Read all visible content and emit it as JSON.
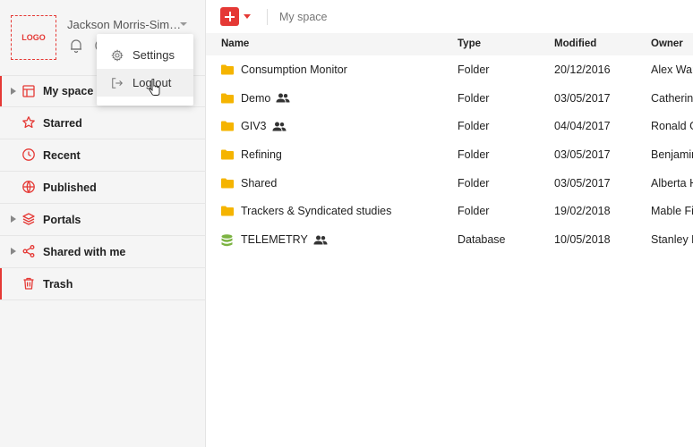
{
  "header": {
    "logo_text": "LOGO",
    "user_name": "Jackson Morris-Sim…"
  },
  "user_menu": {
    "items": [
      {
        "label": "Settings",
        "icon": "gear-icon"
      },
      {
        "label": "Log out",
        "icon": "logout-icon"
      }
    ]
  },
  "sidebar": {
    "items": [
      {
        "label": "My space",
        "icon": "layout-icon",
        "expandable": true,
        "active": true
      },
      {
        "label": "Starred",
        "icon": "star-icon"
      },
      {
        "label": "Recent",
        "icon": "clock-icon"
      },
      {
        "label": "Published",
        "icon": "globe-icon"
      },
      {
        "label": "Portals",
        "icon": "layers-icon",
        "expandable": true
      },
      {
        "label": "Shared with me",
        "icon": "share-icon",
        "expandable": true
      },
      {
        "label": "Trash",
        "icon": "trash-icon"
      }
    ]
  },
  "toolbar": {
    "breadcrumb": "My space"
  },
  "table": {
    "columns": {
      "name": "Name",
      "type": "Type",
      "modified": "Modified",
      "owner": "Owner"
    },
    "rows": [
      {
        "name": "Consumption Monitor",
        "type": "Folder",
        "modified": "20/12/2016",
        "owner": "Alex War",
        "icon": "folder-icon",
        "shared": false
      },
      {
        "name": "Demo",
        "type": "Folder",
        "modified": "03/05/2017",
        "owner": "Catherine",
        "icon": "folder-icon",
        "shared": true
      },
      {
        "name": "GIV3",
        "type": "Folder",
        "modified": "04/04/2017",
        "owner": "Ronald G",
        "icon": "folder-icon",
        "shared": true
      },
      {
        "name": "Refining",
        "type": "Folder",
        "modified": "03/05/2017",
        "owner": "Benjamin",
        "icon": "folder-icon",
        "shared": false
      },
      {
        "name": "Shared",
        "type": "Folder",
        "modified": "03/05/2017",
        "owner": "Alberta H",
        "icon": "folder-icon",
        "shared": false
      },
      {
        "name": "Trackers & Syndicated studies",
        "type": "Folder",
        "modified": "19/02/2018",
        "owner": "Mable Fie",
        "icon": "folder-icon",
        "shared": false
      },
      {
        "name": "TELEMETRY",
        "type": "Database",
        "modified": "10/05/2018",
        "owner": "Stanley K",
        "icon": "database-icon",
        "shared": true
      }
    ]
  },
  "colors": {
    "accent": "#e53935",
    "folder": "#f5b400",
    "database": "#7cb342"
  }
}
